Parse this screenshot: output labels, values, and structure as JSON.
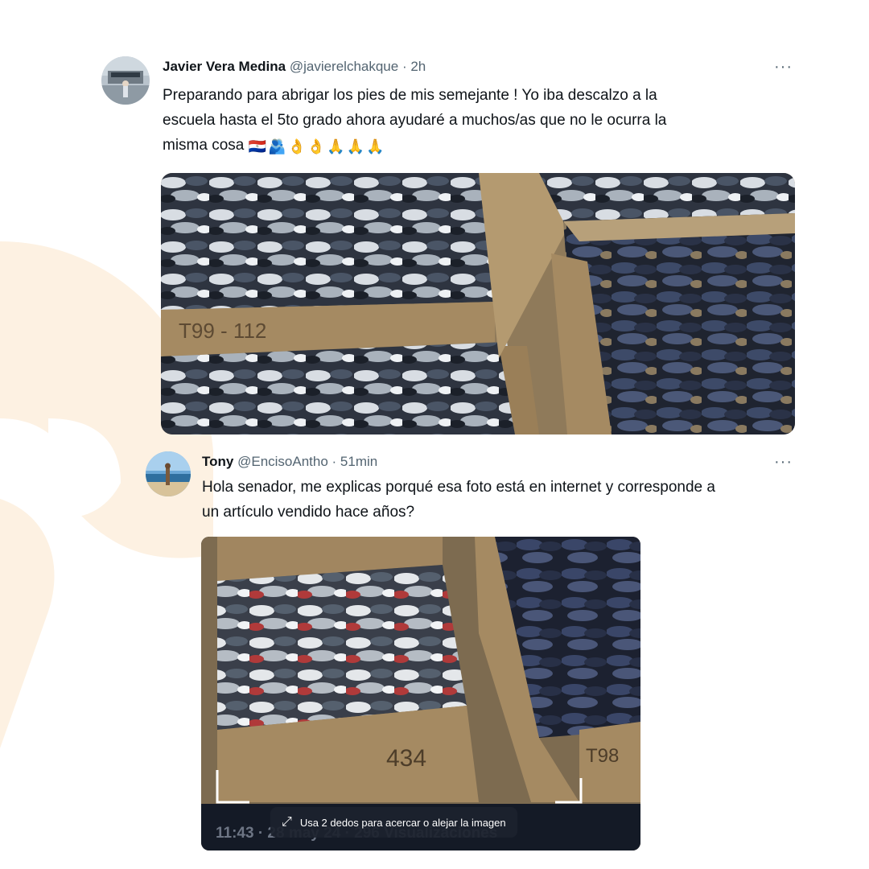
{
  "tweet1": {
    "name": "Javier Vera Medina",
    "handle": "@javierelchakque",
    "time": "· 2h",
    "more": "···",
    "text_line1": "Preparando para abrigar los pies de mis semejante ! Yo iba descalzo a la",
    "text_line2": "escuela hasta el 5to grado ahora ayudaré a muchos/as que no le ocurra la",
    "text_line3": "misma cosa",
    "emojis": [
      "🇵🇾",
      "🫂",
      "👌",
      "👌",
      "🙏",
      "🙏",
      "🙏"
    ]
  },
  "tweet2": {
    "name": "Tony",
    "handle": "@EncisoAntho",
    "time": "· 51min",
    "more": "···",
    "text_line1": "Hola senador, me explicas porqué esa foto está en internet y corresponde a",
    "text_line2": "un artículo vendido hace años?",
    "screenshot_hint": "Usa 2 dedos para acercar o alejar la imagen",
    "screenshot_footer": "11:43 · 28 may 24 · 296 Visualizaciones"
  },
  "box_labels": {
    "box1": "T99 - 112",
    "box2": "434",
    "box3": "T98"
  },
  "colors": {
    "accent_watermark": "#fdf1e2",
    "handle_gray": "#536471",
    "cardboard": "#a58a62"
  }
}
